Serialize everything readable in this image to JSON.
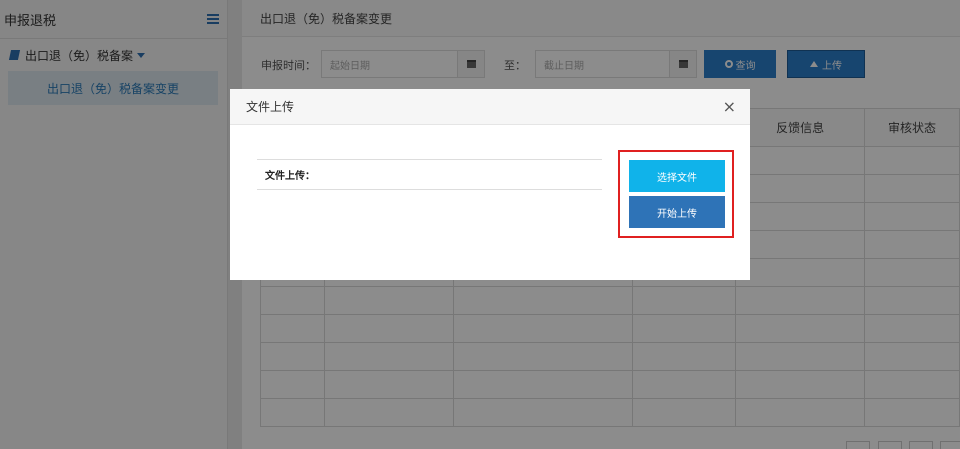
{
  "sidebar": {
    "title": "申报退税",
    "menu_icon": "hamburger-icon",
    "group_label": "出口退（免）税备案",
    "sub_item": "出口退（免）税备案变更"
  },
  "main": {
    "title": "出口退（免）税备案变更",
    "filter": {
      "time_label": "申报时间：",
      "start_placeholder": "起始日期",
      "to_label": "至：",
      "end_placeholder": "截止日期",
      "query_button": "查询",
      "upload_button": "上传"
    },
    "table": {
      "headers": [
        "",
        "",
        "",
        "",
        "反馈信息",
        "审核状态"
      ],
      "row_count": 10
    }
  },
  "modal": {
    "title": "文件上传",
    "close_symbol": "×",
    "field_label": "文件上传：",
    "select_button": "选择文件",
    "start_button": "开始上传"
  },
  "colors": {
    "primary_blue": "#2a7ecb",
    "light_blue": "#10b3ea",
    "highlight_red": "#e02020"
  }
}
